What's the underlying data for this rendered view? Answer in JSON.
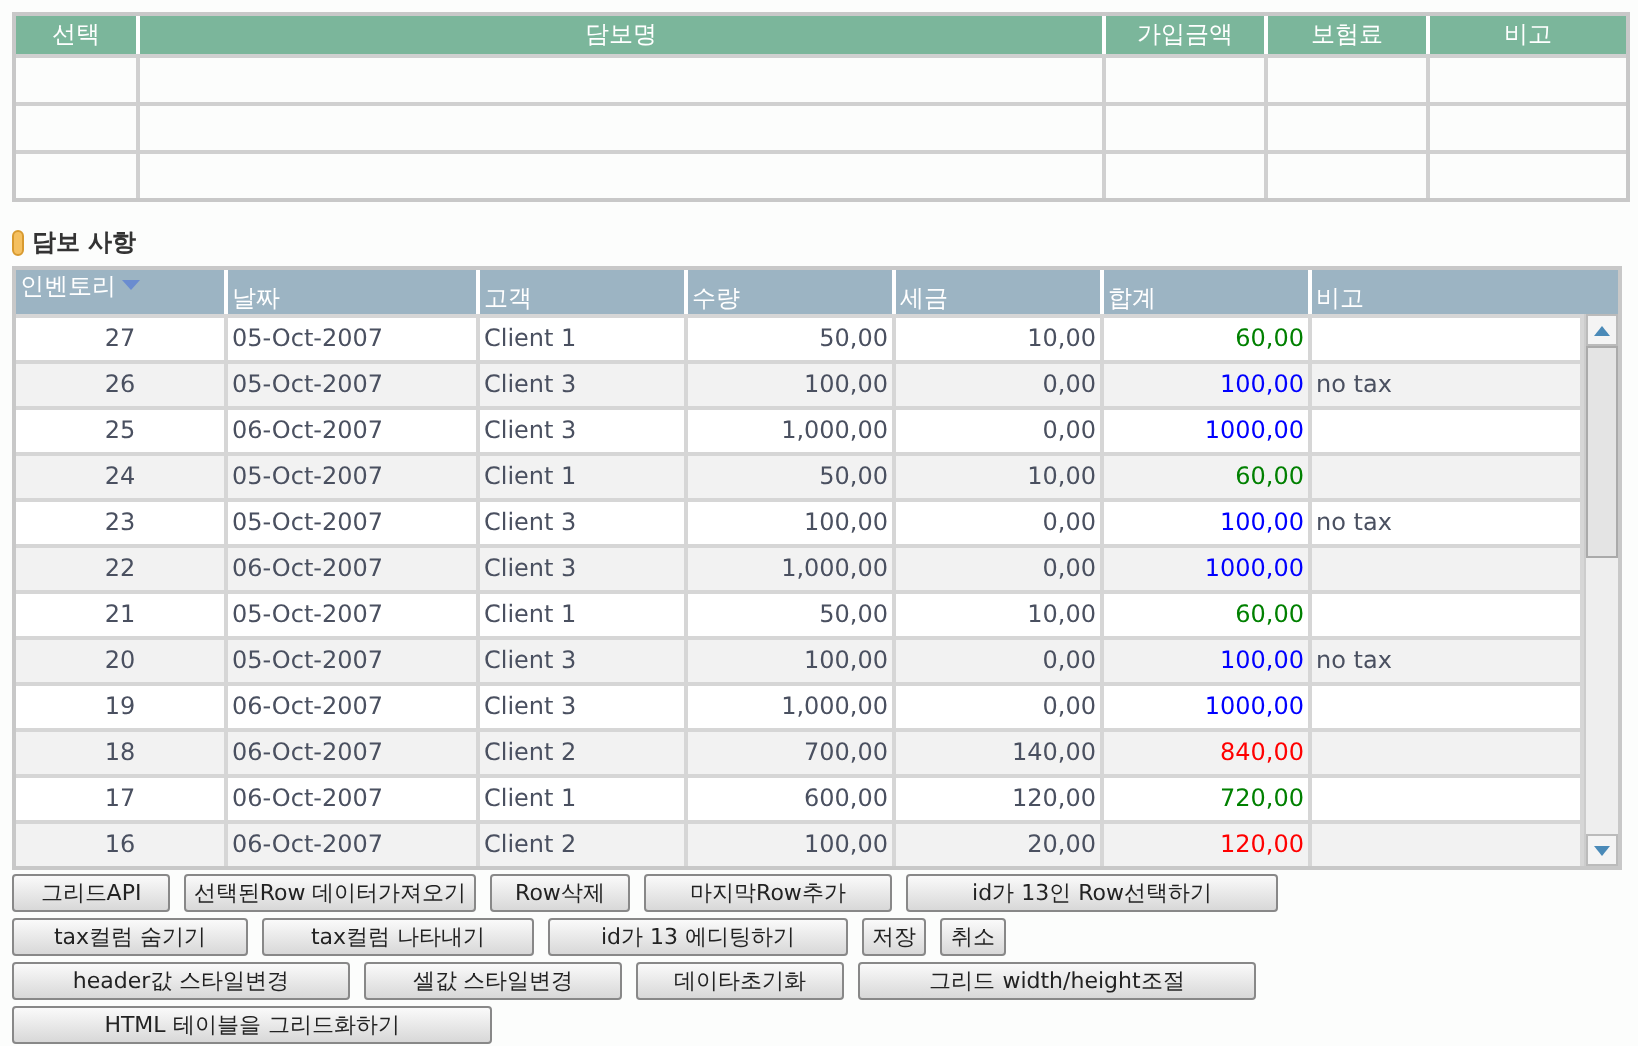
{
  "coverage_table": {
    "columns": [
      "선택",
      "담보명",
      "가입금액",
      "보험료",
      "비고"
    ]
  },
  "section_title": "담보 사항",
  "grid": {
    "columns": [
      {
        "label": "인벤토리",
        "sorted": true
      },
      {
        "label": "날짜",
        "sorted": false
      },
      {
        "label": "고객",
        "sorted": false
      },
      {
        "label": "수량",
        "sorted": false
      },
      {
        "label": "세금",
        "sorted": false
      },
      {
        "label": "합계",
        "sorted": false
      },
      {
        "label": "비고",
        "sorted": false
      }
    ],
    "rows": [
      {
        "cells": [
          "27",
          "05-Oct-2007",
          "Client 1",
          "50,00",
          "10,00",
          "60,00",
          ""
        ],
        "color": "#008000"
      },
      {
        "cells": [
          "26",
          "05-Oct-2007",
          "Client 3",
          "100,00",
          "0,00",
          "100,00",
          "no tax"
        ],
        "color": "#0000ff"
      },
      {
        "cells": [
          "25",
          "06-Oct-2007",
          "Client 3",
          "1,000,00",
          "0,00",
          "1000,00",
          ""
        ],
        "color": "#0000ff"
      },
      {
        "cells": [
          "24",
          "05-Oct-2007",
          "Client 1",
          "50,00",
          "10,00",
          "60,00",
          ""
        ],
        "color": "#008000"
      },
      {
        "cells": [
          "23",
          "05-Oct-2007",
          "Client 3",
          "100,00",
          "0,00",
          "100,00",
          "no tax"
        ],
        "color": "#0000ff"
      },
      {
        "cells": [
          "22",
          "06-Oct-2007",
          "Client 3",
          "1,000,00",
          "0,00",
          "1000,00",
          ""
        ],
        "color": "#0000ff"
      },
      {
        "cells": [
          "21",
          "05-Oct-2007",
          "Client 1",
          "50,00",
          "10,00",
          "60,00",
          ""
        ],
        "color": "#008000"
      },
      {
        "cells": [
          "20",
          "05-Oct-2007",
          "Client 3",
          "100,00",
          "0,00",
          "100,00",
          "no tax"
        ],
        "color": "#0000ff"
      },
      {
        "cells": [
          "19",
          "06-Oct-2007",
          "Client 3",
          "1,000,00",
          "0,00",
          "1000,00",
          ""
        ],
        "color": "#0000ff"
      },
      {
        "cells": [
          "18",
          "06-Oct-2007",
          "Client 2",
          "700,00",
          "140,00",
          "840,00",
          ""
        ],
        "color": "#ff0000"
      },
      {
        "cells": [
          "17",
          "06-Oct-2007",
          "Client 1",
          "600,00",
          "120,00",
          "720,00",
          ""
        ],
        "color": "#008000"
      },
      {
        "cells": [
          "16",
          "06-Oct-2007",
          "Client 2",
          "100,00",
          "20,00",
          "120,00",
          ""
        ],
        "color": "#ff0000"
      }
    ]
  },
  "button_rows": [
    [
      "그리드API",
      "선택된Row 데이터가져오기",
      "Row삭제",
      "마지막Row추가",
      "id가 13인 Row선택하기"
    ],
    [
      "tax컬럼 숨기기",
      "tax컬럼 나타내기",
      "id가 13 에디팅하기",
      "저장",
      "취소"
    ],
    [
      "header값 스타일변경",
      "셀값 스타일변경",
      "데이타초기화",
      "그리드 width/height조절"
    ],
    [
      "HTML 테이블을 그리드화하기"
    ]
  ]
}
